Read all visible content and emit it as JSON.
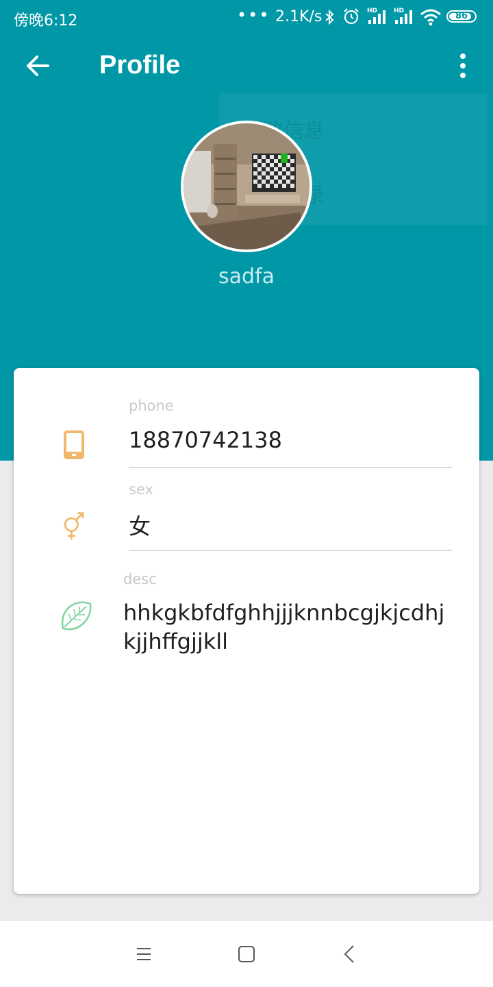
{
  "status_bar": {
    "time": "傍晚6:12",
    "dots": "•••",
    "net_speed": "2.1K/s",
    "hd_label": "HD",
    "battery": "86"
  },
  "toolbar": {
    "title": "Profile"
  },
  "ghost_menu": {
    "items": [
      "修改信息",
      "退出登录"
    ]
  },
  "profile": {
    "username": "sadfa"
  },
  "fields": {
    "phone": {
      "label": "phone",
      "value": "18870742138",
      "icon": "phone-icon",
      "color": "#f0b86a"
    },
    "sex": {
      "label": "sex",
      "value": "女",
      "icon": "gender-icon",
      "color": "#f0b86a"
    },
    "desc": {
      "label": "desc",
      "value": "hhkgkbfdfghhjjjknnbcgjkjcdhjkjjhffgjjkll",
      "icon": "leaf-icon",
      "color": "#7fd4a0"
    }
  },
  "colors": {
    "primary": "#0097a7",
    "card": "#ffffff",
    "background": "#ebebeb"
  },
  "nav": {
    "buttons": [
      "menu-icon",
      "home-icon",
      "back-icon"
    ]
  }
}
